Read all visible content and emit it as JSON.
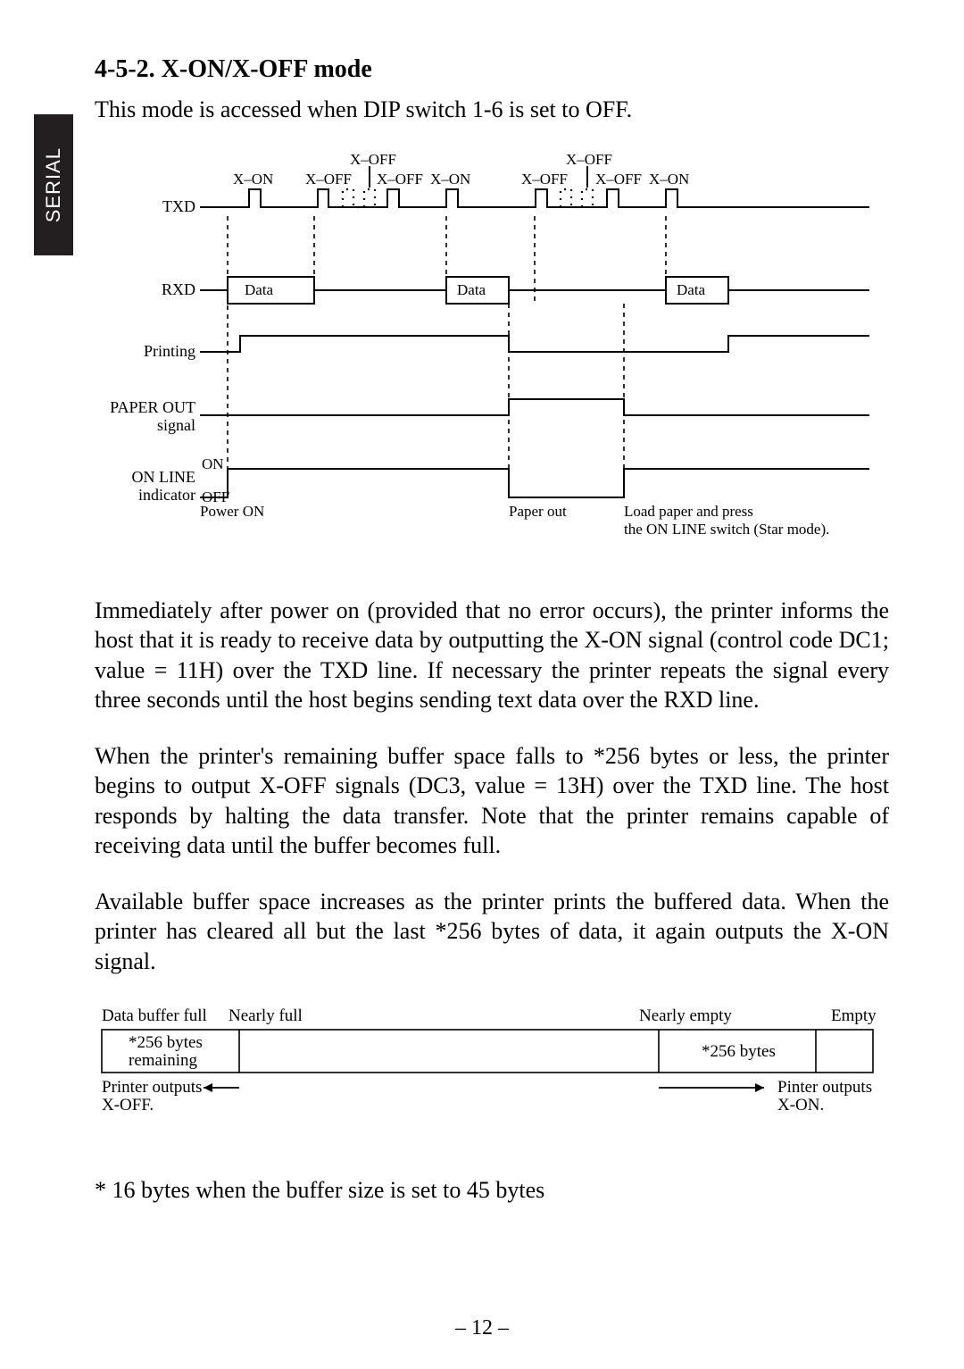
{
  "tab_label": "SERIAL",
  "section_heading": "4-5-2. X-ON/X-OFF mode",
  "intro_text": "This mode is accessed when DIP switch 1-6 is set to OFF.",
  "chart_data": {
    "type": "diagram",
    "signals": [
      "TXD",
      "RXD",
      "Printing",
      "PAPER OUT signal",
      "ON LINE indicator"
    ],
    "txd_annotations": [
      "X–ON",
      "X–OFF",
      "X–OFF",
      "X–OFF",
      "X–ON",
      "X–OFF",
      "X–OFF",
      "X–OFF",
      "X–ON"
    ],
    "rxd_labels": [
      "Data",
      "Data",
      "Data"
    ],
    "online_levels": {
      "on": "ON",
      "off": "OFF"
    },
    "events": {
      "power_on": "Power ON",
      "paper_out": "Paper out",
      "load_paper": "Load paper and press the ON LINE switch (Star mode)."
    }
  },
  "paragraphs": {
    "p1": "Immediately after power on (provided that no error occurs), the printer informs the host that it is ready to receive data by outputting the X-ON signal (control code DC1; value = 11H) over the TXD line.  If necessary the printer repeats the signal every three seconds until the host begins sending text data over the RXD line.",
    "p2": "When the printer's remaining buffer space falls to *256 bytes or less, the printer begins to output X-OFF signals (DC3, value = 13H) over the TXD line.  The host responds by halting the data transfer.  Note that the printer remains capable of receiving data until the buffer becomes full.",
    "p3": "Available buffer space increases as the printer prints the buffered data.  When the printer has cleared all but the last *256 bytes of data, it again outputs the X-ON signal."
  },
  "buffer_diagram": {
    "labels_top": [
      "Data buffer full",
      "Nearly full",
      "Nearly empty",
      "Empty"
    ],
    "boxes": [
      "*256 bytes remaining",
      "*256 bytes"
    ],
    "arrows": [
      "Printer outputs X-OFF.",
      "Pinter outputs X-ON."
    ]
  },
  "footnote": "* 16 bytes when the buffer size is set to 45 bytes",
  "page_number": "– 12 –"
}
